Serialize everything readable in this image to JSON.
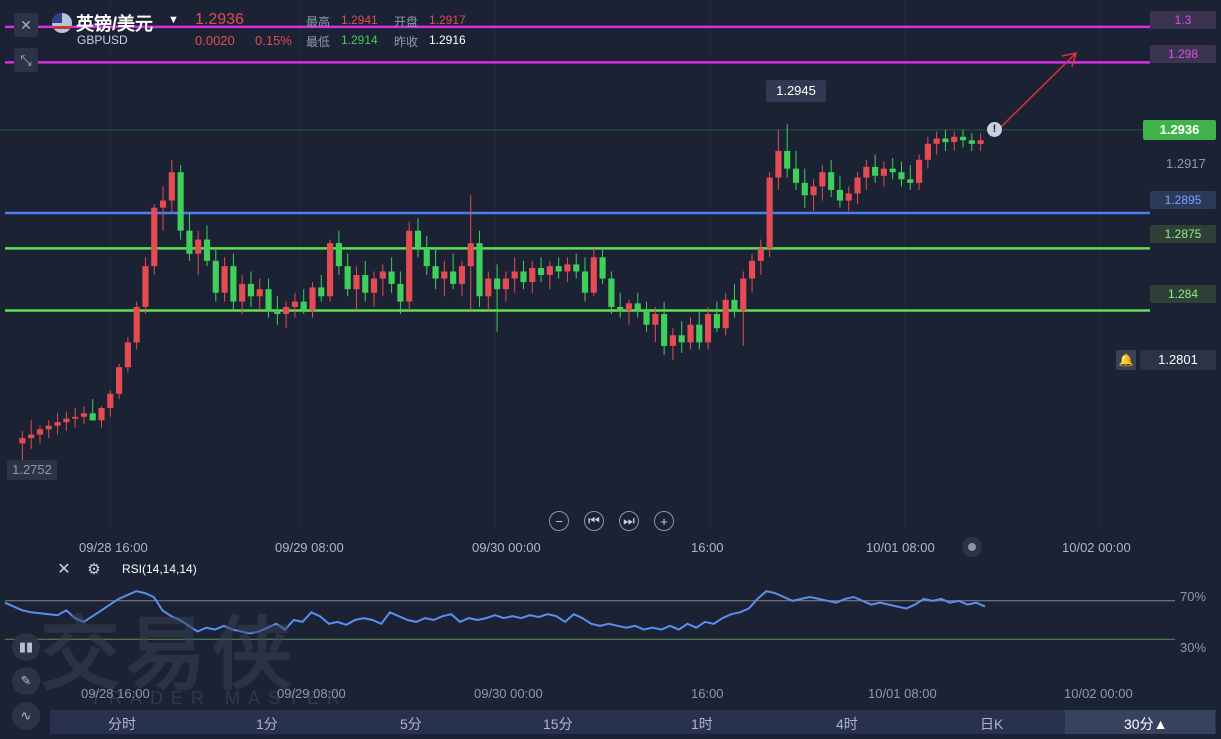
{
  "header": {
    "title": "英镑/美元",
    "symbol": "GBPUSD",
    "price": "1.2936",
    "change": "0.0020",
    "change_pct": "0.15%",
    "high_label": "最高",
    "high": "1.2941",
    "open_label": "开盘",
    "open": "1.2917",
    "low_label": "最低",
    "low": "1.2914",
    "prev_close_label": "昨收",
    "prev_close": "1.2916",
    "close_icon": "close-icon",
    "collapse_icon": "collapse-icon"
  },
  "colors": {
    "up": "#e54b52",
    "down": "#3fcf5a",
    "magenta": "#d62ee0",
    "blue": "#4f7cf2",
    "green_line": "#5ee04f",
    "rsi": "#5b8ef0",
    "background": "#1b2233"
  },
  "price_lines": [
    {
      "label": "1.3",
      "value": 1.3,
      "color": "magenta"
    },
    {
      "label": "1.298",
      "value": 1.298,
      "color": "magenta"
    },
    {
      "label": "1.2895",
      "value": 1.2895,
      "color": "blue"
    },
    {
      "label": "1.2875",
      "value": 1.2875,
      "color": "green_line"
    },
    {
      "label": "1.284",
      "value": 1.284,
      "color": "green_line"
    }
  ],
  "price_tags": {
    "current": "1.2936",
    "axis_1": "1.2917",
    "alert": "1.2801",
    "high_marker": "1.2945",
    "low_marker": "1.2752"
  },
  "time_axis": [
    "09/28 16:00",
    "09/29 08:00",
    "09/30 00:00",
    "16:00",
    "10/01 08:00",
    "10/02 00:00"
  ],
  "rsi": {
    "label": "RSI(14,14,14)",
    "level_70": "70%",
    "level_30": "30%"
  },
  "nav_buttons": [
    "zoom-out",
    "step-back",
    "step-forward",
    "zoom-in"
  ],
  "timeframes": [
    "分时",
    "1分",
    "5分",
    "15分",
    "1时",
    "4时",
    "日K"
  ],
  "active_timeframe": "30分▲",
  "watermark": {
    "cn": "交易侠",
    "en": "TRADER MASTER"
  },
  "chart_data": {
    "type": "candlestick",
    "y_range": [
      1.275,
      1.3005
    ],
    "x_categories": [
      "09/28 16:00",
      "09/29 08:00",
      "09/30 00:00",
      "16:00",
      "10/01 08:00",
      "10/02 00:00"
    ],
    "candles": [
      {
        "o": 1.2765,
        "h": 1.2772,
        "l": 1.2752,
        "c": 1.2768
      },
      {
        "o": 1.2768,
        "h": 1.2778,
        "l": 1.2762,
        "c": 1.277
      },
      {
        "o": 1.277,
        "h": 1.2775,
        "l": 1.2765,
        "c": 1.2773
      },
      {
        "o": 1.2773,
        "h": 1.2778,
        "l": 1.2768,
        "c": 1.2775
      },
      {
        "o": 1.2775,
        "h": 1.2782,
        "l": 1.277,
        "c": 1.2777
      },
      {
        "o": 1.2777,
        "h": 1.2783,
        "l": 1.2772,
        "c": 1.2779
      },
      {
        "o": 1.2779,
        "h": 1.2785,
        "l": 1.2774,
        "c": 1.278
      },
      {
        "o": 1.278,
        "h": 1.2786,
        "l": 1.2776,
        "c": 1.2782
      },
      {
        "o": 1.2782,
        "h": 1.279,
        "l": 1.2778,
        "c": 1.2778
      },
      {
        "o": 1.2778,
        "h": 1.2786,
        "l": 1.2774,
        "c": 1.2785
      },
      {
        "o": 1.2785,
        "h": 1.2795,
        "l": 1.278,
        "c": 1.2793
      },
      {
        "o": 1.2793,
        "h": 1.281,
        "l": 1.279,
        "c": 1.2808
      },
      {
        "o": 1.2808,
        "h": 1.2825,
        "l": 1.2805,
        "c": 1.2822
      },
      {
        "o": 1.2822,
        "h": 1.2845,
        "l": 1.2818,
        "c": 1.2842
      },
      {
        "o": 1.2842,
        "h": 1.287,
        "l": 1.2838,
        "c": 1.2865
      },
      {
        "o": 1.2865,
        "h": 1.29,
        "l": 1.286,
        "c": 1.2898
      },
      {
        "o": 1.2898,
        "h": 1.291,
        "l": 1.2885,
        "c": 1.2902
      },
      {
        "o": 1.2902,
        "h": 1.2925,
        "l": 1.2895,
        "c": 1.2918
      },
      {
        "o": 1.2918,
        "h": 1.2922,
        "l": 1.288,
        "c": 1.2885
      },
      {
        "o": 1.2885,
        "h": 1.2895,
        "l": 1.2868,
        "c": 1.2872
      },
      {
        "o": 1.2872,
        "h": 1.2885,
        "l": 1.286,
        "c": 1.288
      },
      {
        "o": 1.288,
        "h": 1.2888,
        "l": 1.2865,
        "c": 1.2868
      },
      {
        "o": 1.2868,
        "h": 1.2875,
        "l": 1.2845,
        "c": 1.285
      },
      {
        "o": 1.285,
        "h": 1.287,
        "l": 1.2845,
        "c": 1.2865
      },
      {
        "o": 1.2865,
        "h": 1.2872,
        "l": 1.284,
        "c": 1.2845
      },
      {
        "o": 1.2845,
        "h": 1.286,
        "l": 1.2838,
        "c": 1.2855
      },
      {
        "o": 1.2855,
        "h": 1.2862,
        "l": 1.2842,
        "c": 1.2848
      },
      {
        "o": 1.2848,
        "h": 1.2858,
        "l": 1.284,
        "c": 1.2852
      },
      {
        "o": 1.2852,
        "h": 1.2858,
        "l": 1.2836,
        "c": 1.284
      },
      {
        "o": 1.284,
        "h": 1.2848,
        "l": 1.2832,
        "c": 1.2838
      },
      {
        "o": 1.2838,
        "h": 1.2845,
        "l": 1.283,
        "c": 1.2842
      },
      {
        "o": 1.2842,
        "h": 1.285,
        "l": 1.2836,
        "c": 1.2845
      },
      {
        "o": 1.2845,
        "h": 1.2852,
        "l": 1.2838,
        "c": 1.284
      },
      {
        "o": 1.284,
        "h": 1.2856,
        "l": 1.2836,
        "c": 1.2853
      },
      {
        "o": 1.2853,
        "h": 1.286,
        "l": 1.2845,
        "c": 1.2848
      },
      {
        "o": 1.2848,
        "h": 1.288,
        "l": 1.2845,
        "c": 1.2878
      },
      {
        "o": 1.2878,
        "h": 1.2885,
        "l": 1.286,
        "c": 1.2865
      },
      {
        "o": 1.2865,
        "h": 1.2872,
        "l": 1.2848,
        "c": 1.2852
      },
      {
        "o": 1.2852,
        "h": 1.2865,
        "l": 1.284,
        "c": 1.286
      },
      {
        "o": 1.286,
        "h": 1.2868,
        "l": 1.2845,
        "c": 1.285
      },
      {
        "o": 1.285,
        "h": 1.2862,
        "l": 1.2842,
        "c": 1.2858
      },
      {
        "o": 1.2858,
        "h": 1.2866,
        "l": 1.2848,
        "c": 1.2862
      },
      {
        "o": 1.2862,
        "h": 1.287,
        "l": 1.285,
        "c": 1.2855
      },
      {
        "o": 1.2855,
        "h": 1.2862,
        "l": 1.2838,
        "c": 1.2845
      },
      {
        "o": 1.2845,
        "h": 1.289,
        "l": 1.284,
        "c": 1.2885
      },
      {
        "o": 1.2885,
        "h": 1.2892,
        "l": 1.287,
        "c": 1.2875
      },
      {
        "o": 1.2875,
        "h": 1.2882,
        "l": 1.286,
        "c": 1.2865
      },
      {
        "o": 1.2865,
        "h": 1.2875,
        "l": 1.2852,
        "c": 1.2858
      },
      {
        "o": 1.2858,
        "h": 1.2868,
        "l": 1.2848,
        "c": 1.2862
      },
      {
        "o": 1.2862,
        "h": 1.2872,
        "l": 1.2852,
        "c": 1.2855
      },
      {
        "o": 1.2855,
        "h": 1.2868,
        "l": 1.2848,
        "c": 1.2865
      },
      {
        "o": 1.2865,
        "h": 1.2905,
        "l": 1.284,
        "c": 1.2878
      },
      {
        "o": 1.2878,
        "h": 1.2885,
        "l": 1.2842,
        "c": 1.2848
      },
      {
        "o": 1.2848,
        "h": 1.2862,
        "l": 1.284,
        "c": 1.2858
      },
      {
        "o": 1.2858,
        "h": 1.2866,
        "l": 1.2828,
        "c": 1.2852
      },
      {
        "o": 1.2852,
        "h": 1.2862,
        "l": 1.2845,
        "c": 1.2858
      },
      {
        "o": 1.2858,
        "h": 1.287,
        "l": 1.285,
        "c": 1.2862
      },
      {
        "o": 1.2862,
        "h": 1.2868,
        "l": 1.2852,
        "c": 1.2856
      },
      {
        "o": 1.2856,
        "h": 1.2868,
        "l": 1.285,
        "c": 1.2864
      },
      {
        "o": 1.2864,
        "h": 1.287,
        "l": 1.2856,
        "c": 1.286
      },
      {
        "o": 1.286,
        "h": 1.2868,
        "l": 1.2852,
        "c": 1.2865
      },
      {
        "o": 1.2865,
        "h": 1.287,
        "l": 1.2858,
        "c": 1.2862
      },
      {
        "o": 1.2862,
        "h": 1.287,
        "l": 1.2856,
        "c": 1.2866
      },
      {
        "o": 1.2866,
        "h": 1.2872,
        "l": 1.2858,
        "c": 1.2862
      },
      {
        "o": 1.2862,
        "h": 1.287,
        "l": 1.2845,
        "c": 1.285
      },
      {
        "o": 1.285,
        "h": 1.2875,
        "l": 1.2848,
        "c": 1.287
      },
      {
        "o": 1.287,
        "h": 1.2876,
        "l": 1.2855,
        "c": 1.2858
      },
      {
        "o": 1.2858,
        "h": 1.2862,
        "l": 1.2838,
        "c": 1.2842
      },
      {
        "o": 1.2842,
        "h": 1.285,
        "l": 1.2836,
        "c": 1.284
      },
      {
        "o": 1.284,
        "h": 1.2846,
        "l": 1.2832,
        "c": 1.2844
      },
      {
        "o": 1.2844,
        "h": 1.285,
        "l": 1.2836,
        "c": 1.284
      },
      {
        "o": 1.284,
        "h": 1.2845,
        "l": 1.2828,
        "c": 1.2832
      },
      {
        "o": 1.2832,
        "h": 1.2842,
        "l": 1.2822,
        "c": 1.2838
      },
      {
        "o": 1.2838,
        "h": 1.2845,
        "l": 1.2815,
        "c": 1.282
      },
      {
        "o": 1.282,
        "h": 1.283,
        "l": 1.2812,
        "c": 1.2826
      },
      {
        "o": 1.2826,
        "h": 1.2834,
        "l": 1.2816,
        "c": 1.2822
      },
      {
        "o": 1.2822,
        "h": 1.2836,
        "l": 1.2818,
        "c": 1.2832
      },
      {
        "o": 1.2832,
        "h": 1.284,
        "l": 1.2818,
        "c": 1.2822
      },
      {
        "o": 1.2822,
        "h": 1.2842,
        "l": 1.2818,
        "c": 1.2838
      },
      {
        "o": 1.2838,
        "h": 1.2845,
        "l": 1.2828,
        "c": 1.283
      },
      {
        "o": 1.283,
        "h": 1.285,
        "l": 1.2826,
        "c": 1.2846
      },
      {
        "o": 1.2846,
        "h": 1.2855,
        "l": 1.2836,
        "c": 1.284
      },
      {
        "o": 1.284,
        "h": 1.2862,
        "l": 1.282,
        "c": 1.2858
      },
      {
        "o": 1.2858,
        "h": 1.2872,
        "l": 1.285,
        "c": 1.2868
      },
      {
        "o": 1.2868,
        "h": 1.288,
        "l": 1.286,
        "c": 1.2875
      },
      {
        "o": 1.2875,
        "h": 1.2918,
        "l": 1.287,
        "c": 1.2915
      },
      {
        "o": 1.2915,
        "h": 1.2942,
        "l": 1.2908,
        "c": 1.293
      },
      {
        "o": 1.293,
        "h": 1.2945,
        "l": 1.2915,
        "c": 1.292
      },
      {
        "o": 1.292,
        "h": 1.293,
        "l": 1.2908,
        "c": 1.2912
      },
      {
        "o": 1.2912,
        "h": 1.292,
        "l": 1.2898,
        "c": 1.2905
      },
      {
        "o": 1.2905,
        "h": 1.2914,
        "l": 1.2896,
        "c": 1.291
      },
      {
        "o": 1.291,
        "h": 1.2922,
        "l": 1.2902,
        "c": 1.2918
      },
      {
        "o": 1.2918,
        "h": 1.2925,
        "l": 1.2904,
        "c": 1.2908
      },
      {
        "o": 1.2908,
        "h": 1.2916,
        "l": 1.2898,
        "c": 1.2902
      },
      {
        "o": 1.2902,
        "h": 1.291,
        "l": 1.2896,
        "c": 1.2906
      },
      {
        "o": 1.2906,
        "h": 1.2918,
        "l": 1.29,
        "c": 1.2915
      },
      {
        "o": 1.2915,
        "h": 1.2925,
        "l": 1.2908,
        "c": 1.2921
      },
      {
        "o": 1.2921,
        "h": 1.2928,
        "l": 1.2912,
        "c": 1.2916
      },
      {
        "o": 1.2916,
        "h": 1.2924,
        "l": 1.291,
        "c": 1.292
      },
      {
        "o": 1.292,
        "h": 1.2926,
        "l": 1.2914,
        "c": 1.2918
      },
      {
        "o": 1.2918,
        "h": 1.2924,
        "l": 1.291,
        "c": 1.2914
      },
      {
        "o": 1.2914,
        "h": 1.2922,
        "l": 1.2908,
        "c": 1.2912
      },
      {
        "o": 1.2912,
        "h": 1.2928,
        "l": 1.2908,
        "c": 1.2925
      },
      {
        "o": 1.2925,
        "h": 1.2938,
        "l": 1.292,
        "c": 1.2934
      },
      {
        "o": 1.2934,
        "h": 1.2941,
        "l": 1.2928,
        "c": 1.2937
      },
      {
        "o": 1.2937,
        "h": 1.2942,
        "l": 1.293,
        "c": 1.2935
      },
      {
        "o": 1.2935,
        "h": 1.2941,
        "l": 1.293,
        "c": 1.2938
      },
      {
        "o": 1.2938,
        "h": 1.2942,
        "l": 1.2932,
        "c": 1.2936
      },
      {
        "o": 1.2936,
        "h": 1.294,
        "l": 1.293,
        "c": 1.2934
      },
      {
        "o": 1.2934,
        "h": 1.294,
        "l": 1.293,
        "c": 1.2936
      }
    ],
    "rsi_values": [
      68,
      64,
      60,
      58,
      57,
      56,
      55,
      60,
      52,
      48,
      54,
      60,
      66,
      72,
      76,
      80,
      78,
      74,
      60,
      54,
      50,
      44,
      38,
      42,
      40,
      44,
      40,
      38,
      36,
      38,
      42,
      46,
      40,
      50,
      48,
      58,
      54,
      46,
      48,
      45,
      50,
      52,
      50,
      46,
      58,
      54,
      50,
      48,
      52,
      50,
      54,
      56,
      48,
      52,
      50,
      52,
      55,
      52,
      54,
      52,
      55,
      53,
      56,
      54,
      48,
      56,
      52,
      46,
      44,
      46,
      44,
      42,
      44,
      40,
      42,
      40,
      44,
      40,
      46,
      42,
      48,
      46,
      52,
      56,
      58,
      62,
      72,
      80,
      78,
      74,
      70,
      72,
      74,
      72,
      70,
      68,
      72,
      74,
      70,
      66,
      68,
      66,
      64,
      62,
      66,
      72,
      70,
      72,
      68,
      70,
      66,
      68,
      64
    ]
  }
}
